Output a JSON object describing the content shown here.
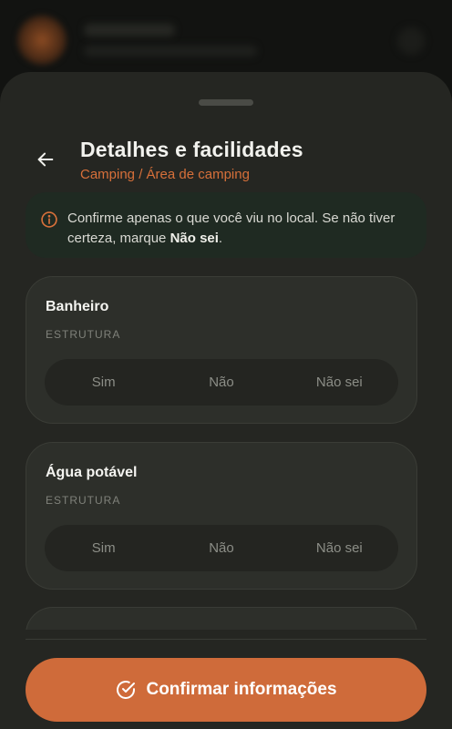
{
  "colors": {
    "accent": "#cf6b3a",
    "sheet_bg": "#252622",
    "card_bg": "#2d2f2a",
    "notice_bg": "#1f2a22"
  },
  "header": {
    "back_icon": "arrow-left-icon",
    "title": "Detalhes e facilidades",
    "breadcrumb": "Camping / Área de camping"
  },
  "notice": {
    "icon": "info-circle-icon",
    "text_before": "Confirme apenas o que você viu no local. Se não tiver certeza, marque ",
    "text_bold": "Não sei",
    "text_after": "."
  },
  "cards": [
    {
      "title": "Banheiro",
      "tag": "ESTRUTURA",
      "options": [
        "Sim",
        "Não",
        "Não sei"
      ]
    },
    {
      "title": "Água potável",
      "tag": "ESTRUTURA",
      "options": [
        "Sim",
        "Não",
        "Não sei"
      ]
    }
  ],
  "footer": {
    "confirm_icon": "check-circle-icon",
    "confirm_label": "Confirmar informações"
  }
}
